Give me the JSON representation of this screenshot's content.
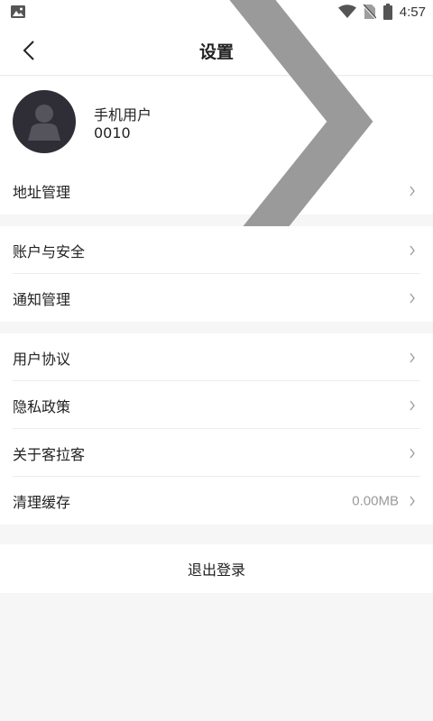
{
  "status_bar": {
    "time": "4:57"
  },
  "header": {
    "title": "设置",
    "back_icon": "chevron-left-icon"
  },
  "profile": {
    "name": "手机用户0010",
    "avatar_icon": "user-avatar-icon"
  },
  "section1": {
    "items": [
      {
        "label": "地址管理"
      }
    ]
  },
  "section2": {
    "items": [
      {
        "label": "账户与安全"
      },
      {
        "label": "通知管理"
      }
    ]
  },
  "section3": {
    "items": [
      {
        "label": "用户协议"
      },
      {
        "label": "隐私政策"
      },
      {
        "label": "关于客拉客"
      },
      {
        "label": "清理缓存",
        "value": "0.00MB"
      }
    ]
  },
  "logout": {
    "label": "退出登录"
  },
  "colors": {
    "background": "#f6f6f6",
    "surface": "#ffffff",
    "avatar_bg": "#2f2e36",
    "secondary_text": "#9a9a9a"
  }
}
